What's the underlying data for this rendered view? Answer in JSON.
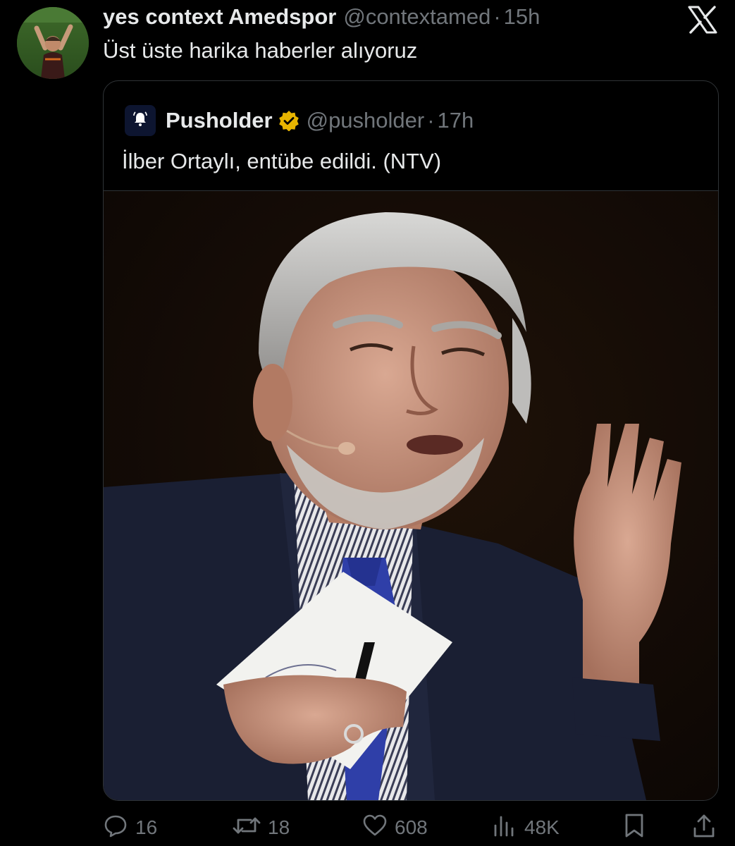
{
  "tweet": {
    "display_name": "yes context Amedspor",
    "handle": "@contextamed",
    "separator": "·",
    "time": "15h",
    "text": "Üst üste harika haberler alıyoruz"
  },
  "quote": {
    "display_name": "Pusholder",
    "handle": "@pusholder",
    "separator": "·",
    "time": "17h",
    "text": "İlber Ortaylı, entübe edildi. (NTV)"
  },
  "actions": {
    "replies": "16",
    "reposts": "18",
    "likes": "608",
    "views": "48K"
  },
  "icons": {
    "platform_logo": "x-logo-icon",
    "quote_avatar": "bell-icon",
    "verified": "verified-badge-icon",
    "reply": "reply-icon",
    "repost": "repost-icon",
    "like": "heart-icon",
    "views": "views-icon",
    "bookmark": "bookmark-icon",
    "share": "share-icon"
  },
  "colors": {
    "background": "#000000",
    "text_primary": "#e7e9ea",
    "text_secondary": "#71767b",
    "border": "#2f3336",
    "verified_gold": "#e8b500"
  }
}
